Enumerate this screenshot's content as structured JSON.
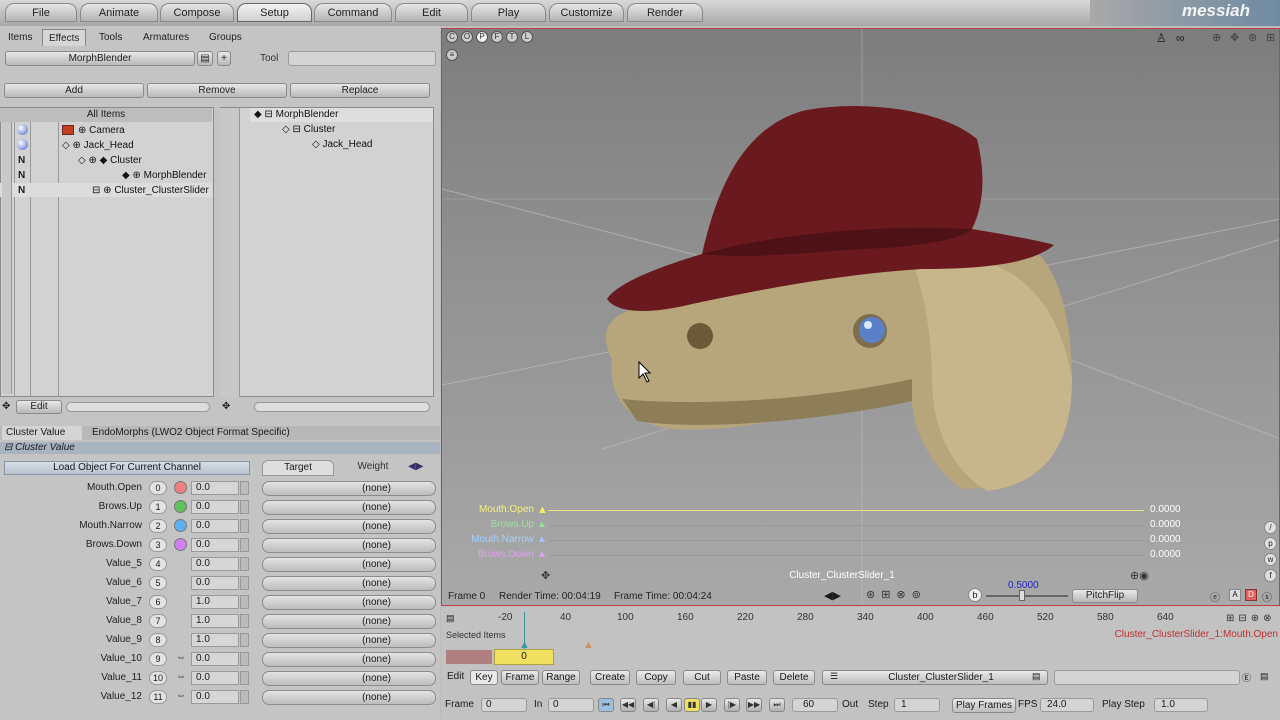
{
  "menu_tabs": [
    "File",
    "Animate",
    "Compose",
    "Setup",
    "Command",
    "Edit",
    "Play",
    "Customize",
    "Render"
  ],
  "logo": "messiah",
  "sub_tabs": [
    "Items",
    "Effects",
    "Tools",
    "Armatures",
    "Groups"
  ],
  "effect_name": "MorphBlender",
  "tool_label": "Tool",
  "buttons": {
    "add": "Add",
    "remove": "Remove",
    "replace": "Replace",
    "edit": "Edit"
  },
  "all_items_header": "All Items",
  "left_tree": [
    "Camera",
    "Jack_Head",
    "Cluster",
    "MorphBlender",
    "Cluster_ClusterSlider"
  ],
  "left_tree_flags": [
    "N",
    "N",
    "N"
  ],
  "right_tree": [
    "MorphBlender",
    "Cluster",
    "Jack_Head"
  ],
  "panel_tabs": [
    "Cluster Value",
    "EndoMorphs (LWO2 Object Format Specific)"
  ],
  "cluster_header": "Cluster Value",
  "load_object_label": "Load Object For Current Channel",
  "target_tab": "Target",
  "weight_tab": "Weight",
  "channels": [
    {
      "name": "Mouth.Open",
      "idx": "0",
      "val": "0.0",
      "dot": "#f08080"
    },
    {
      "name": "Brows.Up",
      "idx": "1",
      "val": "0.0",
      "dot": "#60c060"
    },
    {
      "name": "Mouth.Narrow",
      "idx": "2",
      "val": "0.0",
      "dot": "#60b0f0"
    },
    {
      "name": "Brows.Down",
      "idx": "3",
      "val": "0.0",
      "dot": "#d080f0"
    },
    {
      "name": "Value_5",
      "idx": "4",
      "val": "0.0",
      "dot": ""
    },
    {
      "name": "Value_6",
      "idx": "5",
      "val": "0.0",
      "dot": ""
    },
    {
      "name": "Value_7",
      "idx": "6",
      "val": "1.0",
      "dot": ""
    },
    {
      "name": "Value_8",
      "idx": "7",
      "val": "1.0",
      "dot": ""
    },
    {
      "name": "Value_9",
      "idx": "8",
      "val": "1.0",
      "dot": ""
    },
    {
      "name": "Value_10",
      "idx": "9",
      "val": "0.0",
      "dot": ""
    },
    {
      "name": "Value_11",
      "idx": "10",
      "val": "0.0",
      "dot": ""
    },
    {
      "name": "Value_12",
      "idx": "11",
      "val": "0.0",
      "dot": ""
    }
  ],
  "none_label": "(none)",
  "viewport_buttons": [
    "C",
    "O",
    "P",
    "F",
    "T",
    "L"
  ],
  "slider_overlay": [
    {
      "name": "Mouth.Open",
      "value": "0.0000",
      "color": "#f4f080"
    },
    {
      "name": "Brows.Up",
      "value": "0.0000",
      "color": "#a0e0a0"
    },
    {
      "name": "Mouth.Narrow",
      "value": "0.0000",
      "color": "#a0d0ff"
    },
    {
      "name": "Brows.Down",
      "value": "0.0000",
      "color": "#e0a0f0"
    }
  ],
  "slider_group_name": "Cluster_ClusterSlider_1",
  "status": {
    "frame": "Frame 0",
    "render_time": "Render Time: 00:04:19",
    "frame_time": "Frame Time: 00:04:24"
  },
  "b_label": "b",
  "blend_value": "0.5000",
  "pitchflip": "PitchFlip",
  "ticks": [
    "-20",
    "40",
    "100",
    "160",
    "220",
    "280",
    "340",
    "400",
    "460",
    "520",
    "580",
    "640"
  ],
  "selected_items": "Selected Items",
  "timeline_channel": "Cluster_ClusterSlider_1:Mouth.Open",
  "current_frame": "0",
  "key_bar": [
    "Edit",
    "Key",
    "Frame",
    "Range",
    "Create",
    "Copy",
    "Cut",
    "Paste",
    "Delete"
  ],
  "key_channel": "Cluster_ClusterSlider_1",
  "playbar": {
    "frame_lbl": "Frame",
    "frame_val": "0",
    "in_lbl": "In",
    "in_val": "0",
    "out_val": "60",
    "out_lbl": "Out",
    "step_lbl": "Step",
    "step_val": "1",
    "playframes": "Play Frames",
    "fps_lbl": "FPS",
    "fps_val": "24.0",
    "playstep_lbl": "Play Step",
    "playstep_val": "1.0"
  },
  "colors": {
    "hat": "#6a1a1e",
    "skin": "#b8a67a",
    "accent_red": "#b44444"
  }
}
